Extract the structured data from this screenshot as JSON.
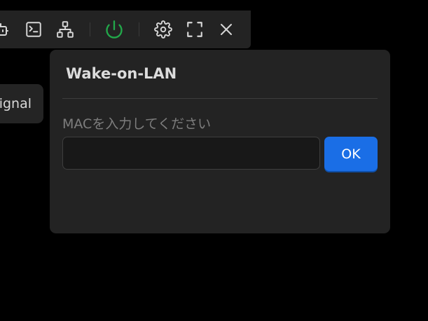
{
  "toolbar": {
    "icons": [
      "robot-icon",
      "terminal-icon",
      "network-icon",
      "power-icon",
      "gear-icon",
      "fullscreen-icon",
      "close-icon"
    ],
    "power_color": "#22a84a",
    "icon_color": "#d6d6d6"
  },
  "left_chip": {
    "text": "ignal"
  },
  "popup": {
    "title": "Wake-on-LAN",
    "mac_label": "MACを入力してください",
    "mac_value": "",
    "ok_label": "OK",
    "accent": "#1a6ee6"
  }
}
